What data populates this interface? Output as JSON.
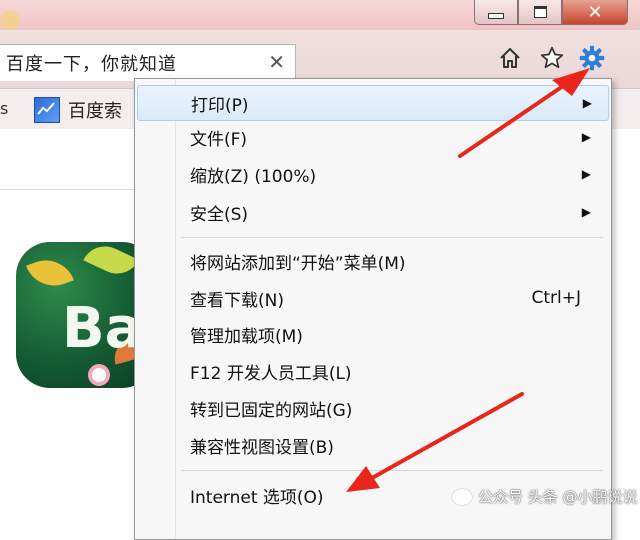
{
  "window": {
    "minimize_glyph": "",
    "maximize_glyph": "",
    "close_label": "✕"
  },
  "tab": {
    "title": "百度一下，你就知道",
    "close_label": "✕"
  },
  "toolbar": {
    "home_icon": "home-icon",
    "favorites_icon": "star-icon",
    "tools_icon": "gear-icon"
  },
  "favorites_bar": {
    "item_label": "百度索"
  },
  "doodle": {
    "text": "Ba"
  },
  "menu": {
    "items": [
      {
        "label": "打印(P)",
        "arrow": "▶"
      },
      {
        "label": "文件(F)",
        "arrow": "▶"
      },
      {
        "label": "缩放(Z) (100%)",
        "arrow": "▶"
      },
      {
        "label": "安全(S)",
        "arrow": "▶"
      },
      {
        "label": "将网站添加到“开始”菜单(M)"
      },
      {
        "label": "查看下载(N)",
        "shortcut": "Ctrl+J"
      },
      {
        "label": "管理加载项(M)"
      },
      {
        "label": "F12 开发人员工具(L)"
      },
      {
        "label": "转到已固定的网站(G)"
      },
      {
        "label": "兼容性视图设置(B)"
      },
      {
        "label": "Internet 选项(O)"
      }
    ]
  },
  "watermark": {
    "text": "公众号 头条 @小鹏说说"
  },
  "colors": {
    "arrow": "#e8261c",
    "gear": "#2d7fd4",
    "menu_hover": "#dbeafa"
  }
}
